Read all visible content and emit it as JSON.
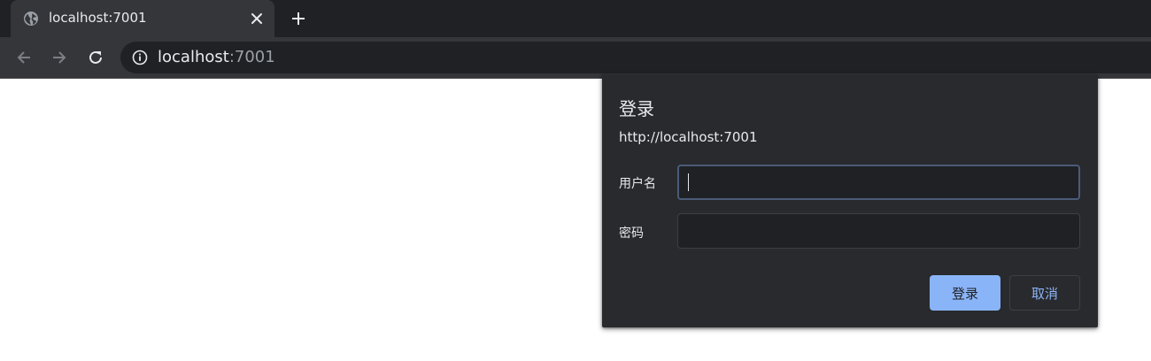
{
  "tab": {
    "title": "localhost:7001",
    "favicon": "globe-icon",
    "close_icon": "close-icon"
  },
  "toolbar": {
    "back_icon": "arrow-left-icon",
    "forward_icon": "arrow-right-icon",
    "reload_icon": "reload-icon",
    "new_tab_icon": "plus-icon",
    "info_icon": "info-icon",
    "url_host": "localhost",
    "url_port": ":7001"
  },
  "dialog": {
    "title": "登录",
    "origin": "http://localhost:7001",
    "username_label": "用户名",
    "username_value": "",
    "password_label": "密码",
    "password_value": "",
    "login_button": "登录",
    "cancel_button": "取消"
  },
  "colors": {
    "accent": "#8ab4f8",
    "dialog_bg": "#292a2d",
    "tabstrip_bg": "#202124",
    "toolbar_bg": "#35363a"
  }
}
